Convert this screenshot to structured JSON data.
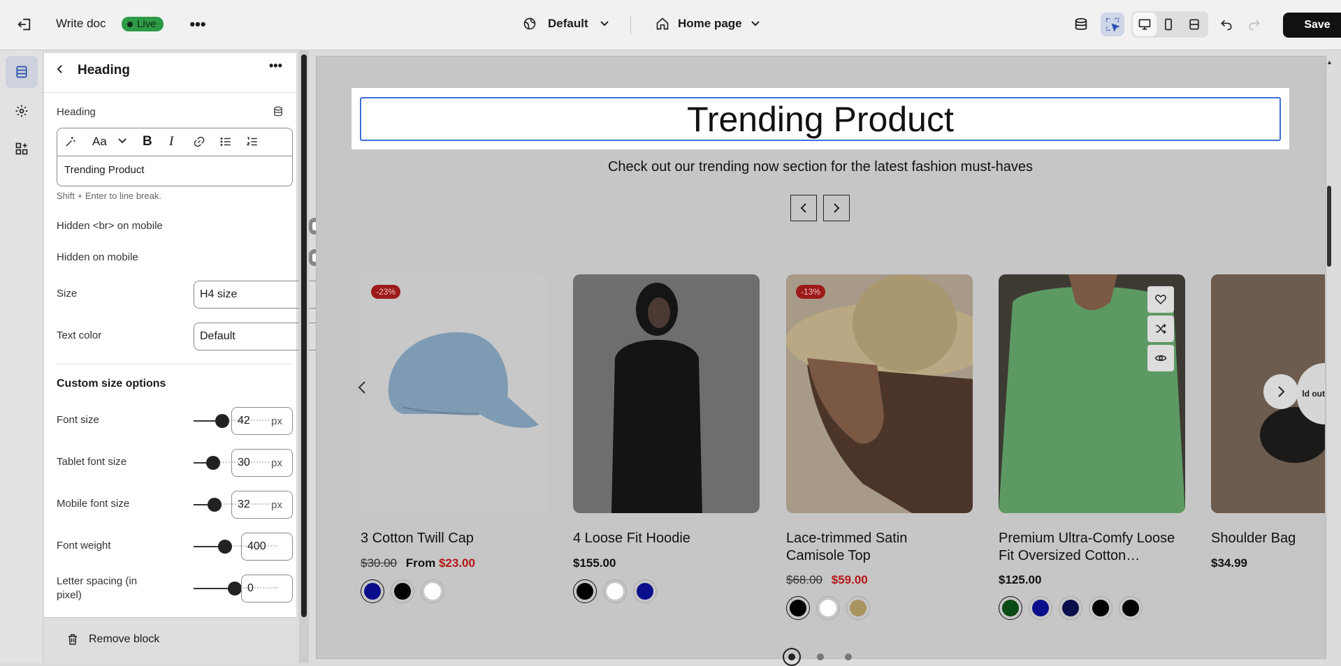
{
  "topbar": {
    "doc_title": "Write doc",
    "status": "Live",
    "theme": "Default",
    "page": "Home page",
    "save_label": "Save"
  },
  "panel": {
    "title": "Heading",
    "field_label": "Heading",
    "heading_text": "Trending Product",
    "hint": "Shift + Enter to line break.",
    "hidden_br_label": "Hidden <br> on mobile",
    "hidden_mobile_label": "Hidden on mobile",
    "size_label": "Size",
    "size_value": "H4 size",
    "text_color_label": "Text color",
    "text_color_value": "Default",
    "custom_section": "Custom size options",
    "font_size_label": "Font size",
    "font_size_value": "42",
    "tablet_font_label": "Tablet font size",
    "tablet_font_value": "30",
    "mobile_font_label": "Mobile font size",
    "mobile_font_value": "32",
    "font_weight_label": "Font weight",
    "font_weight_value": "400",
    "letter_spacing_label": "Letter spacing (in pixel)",
    "letter_spacing_value": "0",
    "unit": "px",
    "remove_label": "Remove block"
  },
  "preview": {
    "heading": "Trending Product",
    "subtitle": "Check out our trending now section for the latest fashion must-haves",
    "products": [
      {
        "name": "3 Cotton Twill Cap",
        "discount": "-23%",
        "old_price": "$30.00",
        "price_prefix": "From",
        "price": "$23.00",
        "swatches": [
          "#0a0e8a",
          "#000000",
          "#ffffff"
        ]
      },
      {
        "name": "4 Loose Fit Hoodie",
        "price": "$155.00",
        "swatches": [
          "#000000",
          "#ffffff",
          "#0a0e8a"
        ]
      },
      {
        "name": "Lace-trimmed Satin Camisole Top",
        "discount": "-13%",
        "old_price": "$68.00",
        "price": "$59.00",
        "swatches": [
          "#000000",
          "#ffffff",
          "#a89460"
        ]
      },
      {
        "name": "Premium Ultra-Comfy Loose Fit Oversized Cotton…",
        "price": "$125.00",
        "swatches": [
          "#0b4a12",
          "#0a0e8a",
          "#0a0e4a",
          "#000000",
          "#000000"
        ]
      },
      {
        "name": "Shoulder Bag",
        "price": "$34.99",
        "badge": "ld out"
      }
    ]
  },
  "colors": {
    "accent": "#3d6fd6",
    "live": "#2e9a47",
    "sale": "#b51616"
  }
}
